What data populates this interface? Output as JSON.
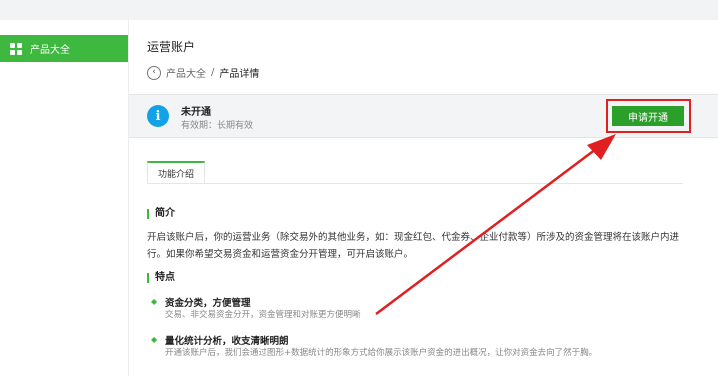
{
  "sidebar": {
    "active_item": "产品大全"
  },
  "main": {
    "title": "运营账户",
    "breadcrumb": {
      "back_icon": "‹",
      "parent": "产品大全",
      "separator": "/",
      "current": "产品详情"
    }
  },
  "status": {
    "icon": "i",
    "label": "未开通",
    "validity": "有效期：长期有效",
    "apply_button": "申请开通"
  },
  "tabs": [
    {
      "label": "功能介绍",
      "active": true
    }
  ],
  "intro": {
    "heading": "简介",
    "text": "开启该账户后，你的运营业务（除交易外的其他业务，如：现金红包、代金券、企业付款等）所涉及的资金管理将在该账户内进行。如果你希望交易资金和运营资金分开管理，可开启该账户。"
  },
  "features": {
    "heading": "特点",
    "items": [
      {
        "title": "资金分类，方便管理",
        "desc": "交易、非交易资金分开，资金管理和对账更方便明晰"
      },
      {
        "title": "量化统计分析，收支清晰明朗",
        "desc": "开通该账户后，我们会通过图形+数据统计的形象方式给你展示该账户资金的进出概况，让你对资金去向了然于胸。"
      }
    ]
  },
  "colors": {
    "accent_green": "#3fb83f",
    "button_green": "#2aa02a",
    "info_blue": "#11a2e8",
    "highlight_red": "#e02020"
  }
}
